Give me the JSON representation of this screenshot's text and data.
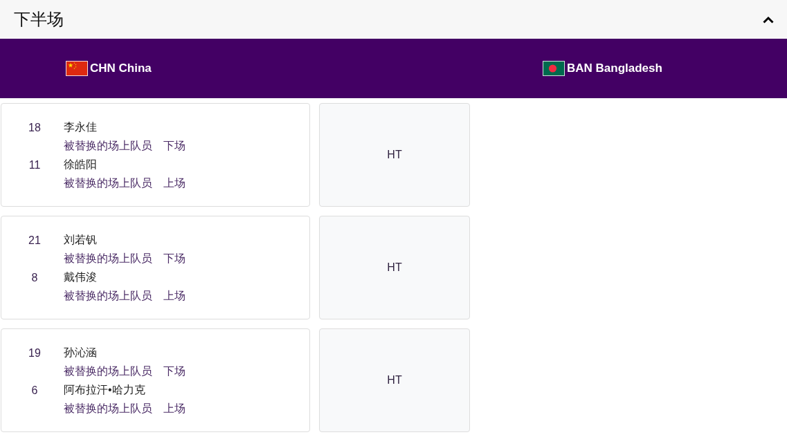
{
  "section": {
    "title": "下半场",
    "expanded": true
  },
  "teams": [
    {
      "kind": "cn",
      "label": "CHN China"
    },
    {
      "kind": "bd",
      "label": "BAN Bangladesh"
    }
  ],
  "substitutions": [
    {
      "players": [
        {
          "number": "18",
          "name": "李永佳",
          "role": "被替换的场上队员",
          "action": "下场"
        },
        {
          "number": "11",
          "name": "徐皓阳",
          "role": "被替换的场上队员",
          "action": "上场"
        }
      ],
      "time": "HT"
    },
    {
      "players": [
        {
          "number": "21",
          "name": "刘若钒",
          "role": "被替换的场上队员",
          "action": "下场"
        },
        {
          "number": "8",
          "name": "戴伟浚",
          "role": "被替换的场上队员",
          "action": "上场"
        }
      ],
      "time": "HT"
    },
    {
      "players": [
        {
          "number": "19",
          "name": "孙沁涵",
          "role": "被替换的场上队员",
          "action": "下场"
        },
        {
          "number": "6",
          "name": "阿布拉汗•哈力克",
          "role": "被替换的场上队员",
          "action": "上场"
        }
      ],
      "time": "HT"
    }
  ]
}
